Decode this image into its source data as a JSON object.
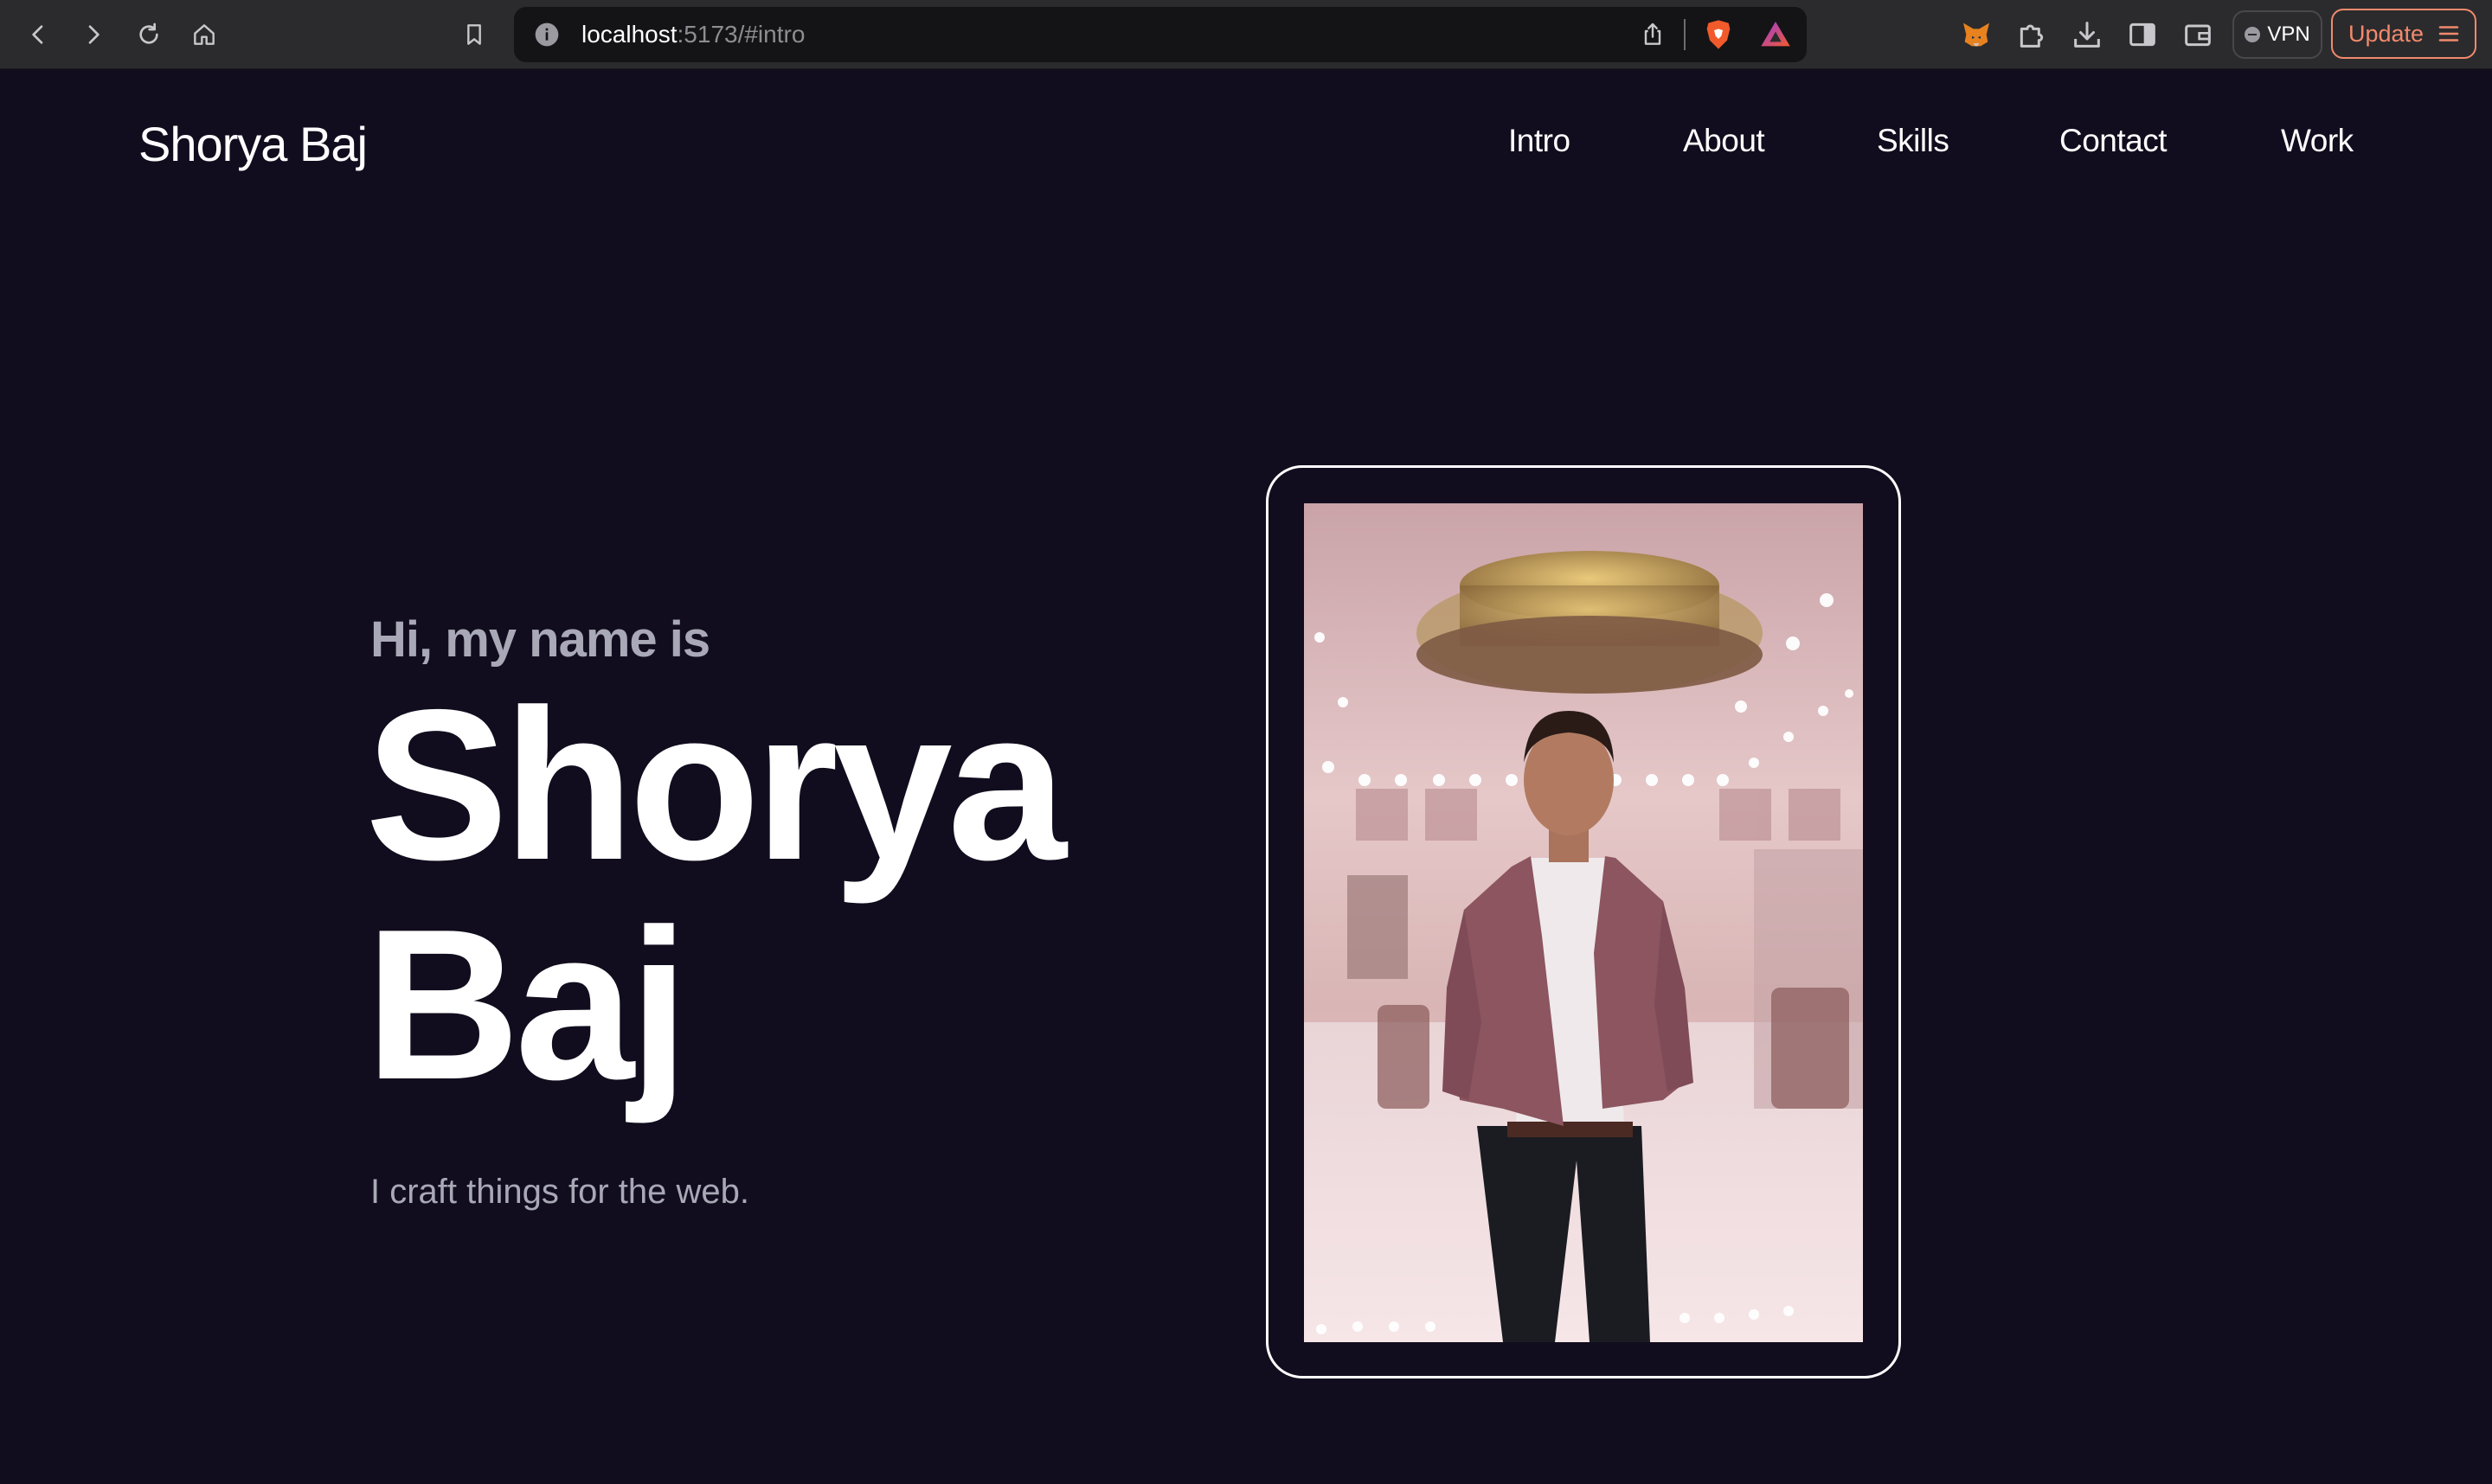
{
  "browser": {
    "url_host": "localhost",
    "url_rest": ":5173/#intro",
    "vpn_label": "VPN",
    "update_label": "Update",
    "icons": [
      "back-icon",
      "forward-icon",
      "reload-icon",
      "home-icon",
      "bookmark-icon",
      "site-info-icon",
      "share-icon",
      "brave-shields-icon",
      "brave-rewards-icon",
      "metamask-fox-icon",
      "extensions-puzzle-icon",
      "download-icon",
      "sidebar-icon",
      "wallet-icon",
      "menu-icon"
    ]
  },
  "site": {
    "logo": "Shorya Baj",
    "nav": [
      "Intro",
      "About",
      "Skills",
      "Contact",
      "Work"
    ]
  },
  "hero": {
    "greeting": "Hi, my name is",
    "name_line1": "Shorya",
    "name_line2": "Baj",
    "tagline": "I craft things for the web."
  },
  "colors": {
    "page_bg": "#110d1e",
    "text_primary": "#ffffff",
    "text_muted": "#a9a8b6",
    "chrome_bg": "#2b2b2e",
    "update_accent": "#f28a6b"
  }
}
